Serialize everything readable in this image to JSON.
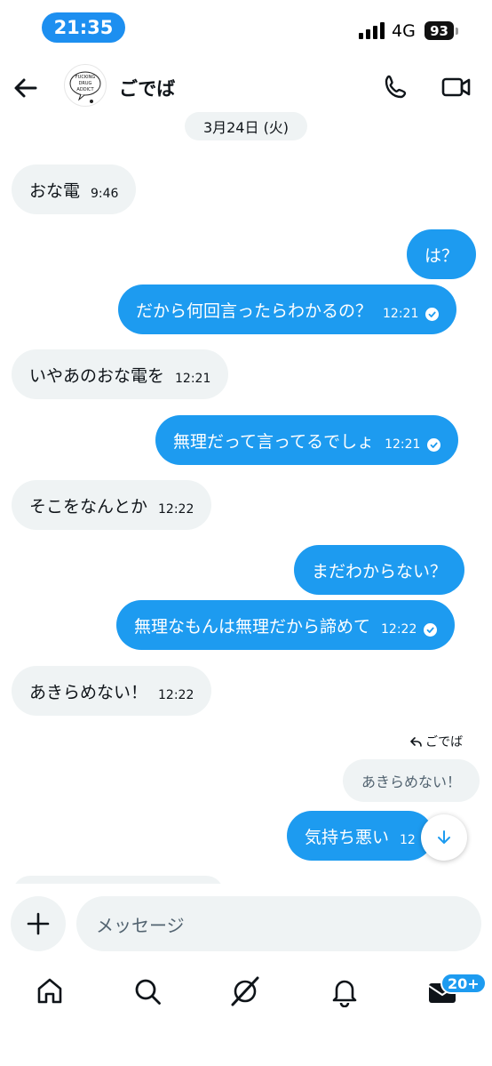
{
  "status_bar": {
    "time": "21:35",
    "network": "4G",
    "battery": "93"
  },
  "header": {
    "contact_name": "ごでば",
    "avatar_text": "FUCKING DRUG ADDICT"
  },
  "date_divider": "3月24日 (火)",
  "messages": [
    {
      "dir": "in",
      "text": "おな電",
      "time": "9:46"
    },
    {
      "dir": "out",
      "text": "は？",
      "time": ""
    },
    {
      "dir": "out",
      "text": "だから何回言ったらわかるの？",
      "time": "12:21"
    },
    {
      "dir": "in",
      "text": "いやあのおな電を",
      "time": "12:21"
    },
    {
      "dir": "out",
      "text": "無理だって言ってるでしょ",
      "time": "12:21"
    },
    {
      "dir": "in",
      "text": "そこをなんとか",
      "time": "12:22"
    },
    {
      "dir": "out",
      "text": "まだわからない？",
      "time": ""
    },
    {
      "dir": "out",
      "text": "無理なもんは無理だから諦めて",
      "time": "12:22"
    },
    {
      "dir": "in",
      "text": "あきらめない！",
      "time": "12:22"
    },
    {
      "dir": "out",
      "text": "気持ち悪い",
      "time": "12"
    }
  ],
  "reply": {
    "replying_to": "ごでば",
    "quoted_text": "あきらめない！"
  },
  "composer": {
    "placeholder": "メッセージ"
  },
  "tab_bar": {
    "messages_badge": "20+"
  },
  "colors": {
    "accent": "#1d9bf0",
    "time_pill": "#1d8ff0",
    "incoming_bubble": "#eff3f4"
  }
}
